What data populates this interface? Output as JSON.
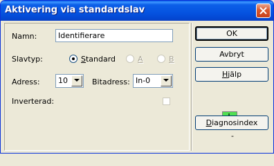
{
  "window": {
    "title": "Aktivering via standardslav"
  },
  "form": {
    "name_label": "Namn:",
    "name_value": "Identifierare",
    "slave_type_label": "Slavtyp:",
    "slave_type_options": [
      {
        "label": "Standard",
        "selected": true,
        "enabled": true
      },
      {
        "label": "A",
        "selected": false,
        "enabled": false
      },
      {
        "label": "B",
        "selected": false,
        "enabled": false
      }
    ],
    "address_label": "Adress:",
    "address_value": "10",
    "bit_address_label": "Bitadress:",
    "bit_address_value": "In-0",
    "inverted_label": "Inverterad:",
    "inverted_checked": false
  },
  "buttons": {
    "ok": "OK",
    "cancel": "Avbryt",
    "help": "Hjälp",
    "diagnostic_index": "Diagnosindex"
  },
  "status": {
    "led_color": "#52e052",
    "diag_value": "-"
  }
}
